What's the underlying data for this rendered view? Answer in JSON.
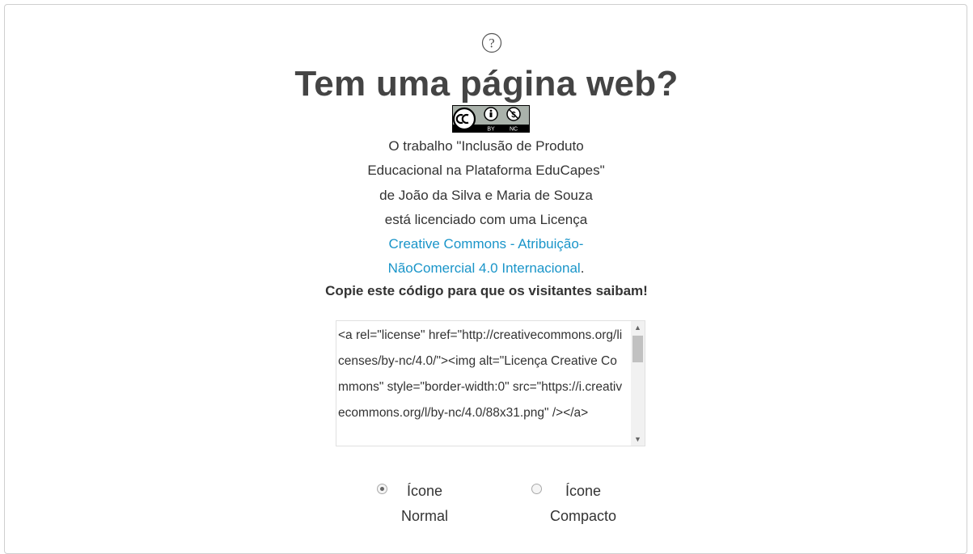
{
  "help": {
    "icon": "question-circle-icon",
    "glyph": "?"
  },
  "title": "Tem uma página web?",
  "badge": {
    "icon": "cc-by-nc-icon",
    "by_text": "BY",
    "nc_text": "NC"
  },
  "attribution": {
    "line1": "O trabalho \"Inclusão de Produto",
    "line2": "Educacional na Plataforma EduCapes\"",
    "line3": "de João da Silva e Maria de Souza",
    "line4": "está licenciado com uma Licença",
    "link_line1": "Creative Commons - Atribuição-",
    "link_line2": "NãoComercial 4.0 Internacional",
    "period": "."
  },
  "copy_prompt": "Copie este código para que os visitantes saibam!",
  "code": "<a rel=\"license\" href=\"http://creativecommons.org/licenses/by-nc/4.0/\"><img alt=\"Licença Creative Commons\" style=\"border-width:0\" src=\"https://i.creativecommons.org/l/by-nc/4.0/88x31.png\" /></a>",
  "options": [
    {
      "line1": "Ícone",
      "line2": "Normal",
      "checked": true
    },
    {
      "line1": "Ícone",
      "line2": "Compacto",
      "checked": false
    }
  ],
  "colors": {
    "link": "#1a95c9",
    "title": "#444444",
    "text": "#333333"
  }
}
